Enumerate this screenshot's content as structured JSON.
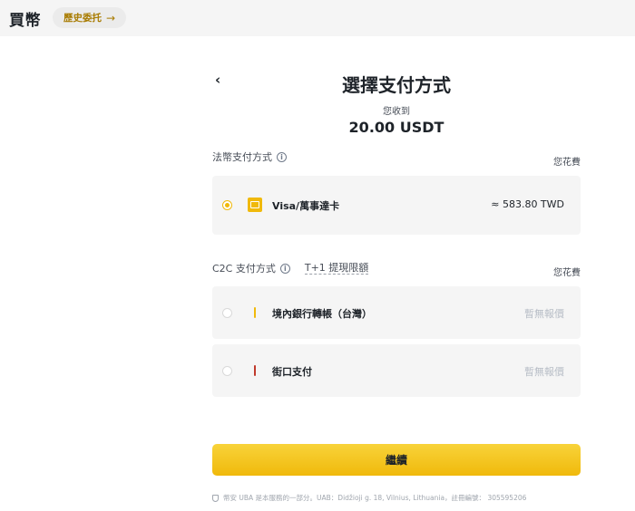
{
  "header": {
    "title": "買幣",
    "history_label": "歷史委托",
    "history_arrow": "→"
  },
  "panel": {
    "back_glyph": "‹",
    "title": "選擇支付方式",
    "receive_label": "您收到",
    "receive_amount": "20.00 USDT"
  },
  "fiat_section": {
    "label": "法幣支付方式",
    "spend_label": "您花費",
    "options": [
      {
        "label": "Visa/萬事達卡",
        "value": "≈ 583.80 TWD",
        "selected": true,
        "icon": "credit-card-icon",
        "icon_color": "#f0b90b"
      }
    ]
  },
  "c2c_section": {
    "label": "C2C 支付方式",
    "limit_link": "T+1 提現限額",
    "spend_label": "您花費",
    "options": [
      {
        "label": "境內銀行轉帳（台灣）",
        "value": "暫無報價",
        "selected": false,
        "icon": "payment-bar-icon",
        "icon_color": "#f0b90b"
      },
      {
        "label": "街口支付",
        "value": "暫無報價",
        "selected": false,
        "icon": "payment-bar-icon",
        "icon_color": "#c0392b"
      }
    ]
  },
  "continue_label": "繼續",
  "footer_text": "幣安 UBA 是本服務的一部分。UAB：Didžioji g. 18, Vilnius, Lithuania，註冊編號： 305595206",
  "colors": {
    "accent": "#f0b90b",
    "card_bg": "#f5f5f5",
    "muted_text": "#b7bdc6"
  }
}
